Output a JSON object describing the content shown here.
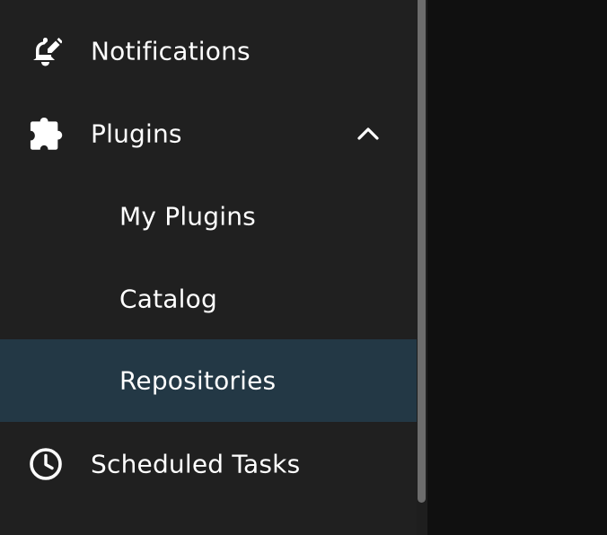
{
  "sidebar": {
    "items": [
      {
        "label": "Notifications",
        "icon": "notifications-edit-icon"
      },
      {
        "label": "Plugins",
        "icon": "puzzle-icon",
        "expanded": true
      },
      {
        "label": "My Plugins"
      },
      {
        "label": "Catalog"
      },
      {
        "label": "Repositories",
        "active": true
      },
      {
        "label": "Scheduled Tasks",
        "icon": "clock-icon"
      }
    ]
  },
  "colors": {
    "sidebar_bg": "#202020",
    "content_bg": "#101010",
    "active_bg": "#233845",
    "text": "#ffffff"
  }
}
